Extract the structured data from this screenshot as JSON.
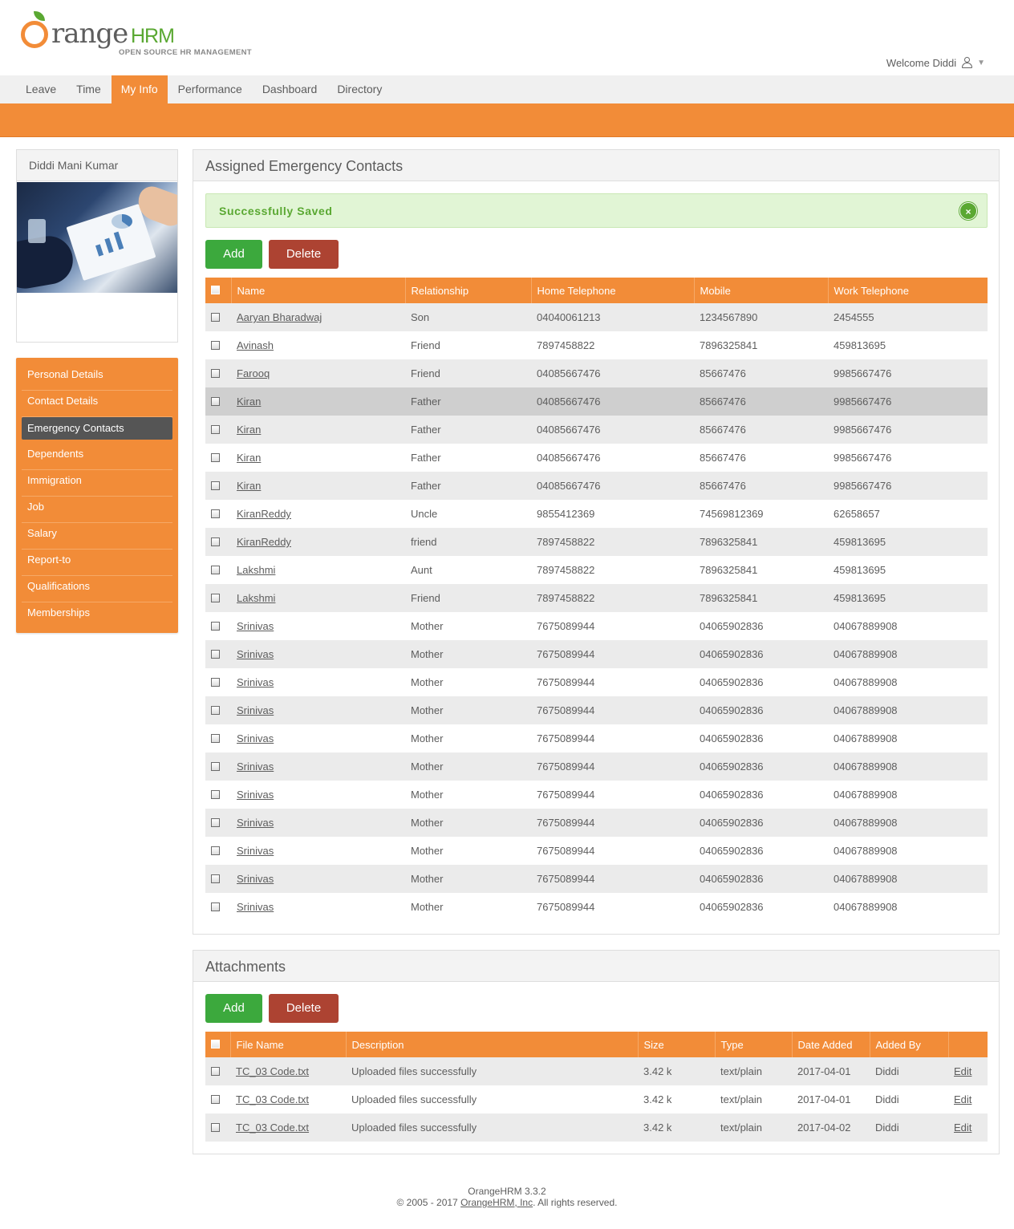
{
  "header": {
    "logo_word": "range",
    "logo_hrm": "HRM",
    "logo_tagline": "OPEN SOURCE HR MANAGEMENT",
    "welcome": "Welcome Diddi"
  },
  "menu": [
    "Leave",
    "Time",
    "My Info",
    "Performance",
    "Dashboard",
    "Directory"
  ],
  "sidebar": {
    "profile_name": "Diddi Mani Kumar",
    "items": [
      "Personal Details",
      "Contact Details",
      "Emergency Contacts",
      "Dependents",
      "Immigration",
      "Job",
      "Salary",
      "Report-to",
      "Qualifications",
      "Memberships"
    ]
  },
  "emergency": {
    "title": "Assigned Emergency Contacts",
    "message": "Successfully Saved",
    "close_label": "×",
    "add_label": "Add",
    "delete_label": "Delete",
    "columns": [
      "Name",
      "Relationship",
      "Home Telephone",
      "Mobile",
      "Work Telephone"
    ],
    "rows": [
      [
        "Aaryan Bharadwaj",
        "Son",
        "04040061213",
        "1234567890",
        "2454555"
      ],
      [
        "Avinash",
        "Friend",
        "7897458822",
        "7896325841",
        "459813695"
      ],
      [
        "Farooq",
        "Friend",
        "04085667476",
        "85667476",
        "9985667476"
      ],
      [
        "Kiran",
        "Father",
        "04085667476",
        "85667476",
        "9985667476"
      ],
      [
        "Kiran",
        "Father",
        "04085667476",
        "85667476",
        "9985667476"
      ],
      [
        "Kiran",
        "Father",
        "04085667476",
        "85667476",
        "9985667476"
      ],
      [
        "Kiran",
        "Father",
        "04085667476",
        "85667476",
        "9985667476"
      ],
      [
        "KiranReddy",
        "Uncle",
        "9855412369",
        "74569812369",
        "62658657"
      ],
      [
        "KiranReddy",
        "friend",
        "7897458822",
        "7896325841",
        "459813695"
      ],
      [
        "Lakshmi",
        "Aunt",
        "7897458822",
        "7896325841",
        "459813695"
      ],
      [
        "Lakshmi",
        "Friend",
        "7897458822",
        "7896325841",
        "459813695"
      ],
      [
        "Srinivas",
        "Mother",
        "7675089944",
        "04065902836",
        "04067889908"
      ],
      [
        "Srinivas",
        "Mother",
        "7675089944",
        "04065902836",
        "04067889908"
      ],
      [
        "Srinivas",
        "Mother",
        "7675089944",
        "04065902836",
        "04067889908"
      ],
      [
        "Srinivas",
        "Mother",
        "7675089944",
        "04065902836",
        "04067889908"
      ],
      [
        "Srinivas",
        "Mother",
        "7675089944",
        "04065902836",
        "04067889908"
      ],
      [
        "Srinivas",
        "Mother",
        "7675089944",
        "04065902836",
        "04067889908"
      ],
      [
        "Srinivas",
        "Mother",
        "7675089944",
        "04065902836",
        "04067889908"
      ],
      [
        "Srinivas",
        "Mother",
        "7675089944",
        "04065902836",
        "04067889908"
      ],
      [
        "Srinivas",
        "Mother",
        "7675089944",
        "04065902836",
        "04067889908"
      ],
      [
        "Srinivas",
        "Mother",
        "7675089944",
        "04065902836",
        "04067889908"
      ],
      [
        "Srinivas",
        "Mother",
        "7675089944",
        "04065902836",
        "04067889908"
      ]
    ]
  },
  "attachments": {
    "title": "Attachments",
    "add_label": "Add",
    "delete_label": "Delete",
    "columns": [
      "File Name",
      "Description",
      "Size",
      "Type",
      "Date Added",
      "Added By",
      ""
    ],
    "rows": [
      [
        "TC_03 Code.txt",
        "Uploaded files successfully",
        "3.42 k",
        "text/plain",
        "2017-04-01",
        "Diddi",
        "Edit"
      ],
      [
        "TC_03 Code.txt",
        "Uploaded files successfully",
        "3.42 k",
        "text/plain",
        "2017-04-01",
        "Diddi",
        "Edit"
      ],
      [
        "TC_03 Code.txt",
        "Uploaded files successfully",
        "3.42 k",
        "text/plain",
        "2017-04-02",
        "Diddi",
        "Edit"
      ]
    ]
  },
  "footer": {
    "version": "OrangeHRM 3.3.2",
    "copyright_prefix": "© 2005 - 2017 ",
    "company_link": "OrangeHRM, Inc",
    "copyright_suffix": ". All rights reserved."
  },
  "colors": {
    "accent": "#f28c38",
    "add_button": "#3ca93d",
    "delete_button": "#ad4332",
    "success": "#5aa832"
  },
  "state": {
    "active_menu": "My Info",
    "active_sidebar_item": "Emergency Contacts",
    "hovered_emergency_row": 3
  }
}
